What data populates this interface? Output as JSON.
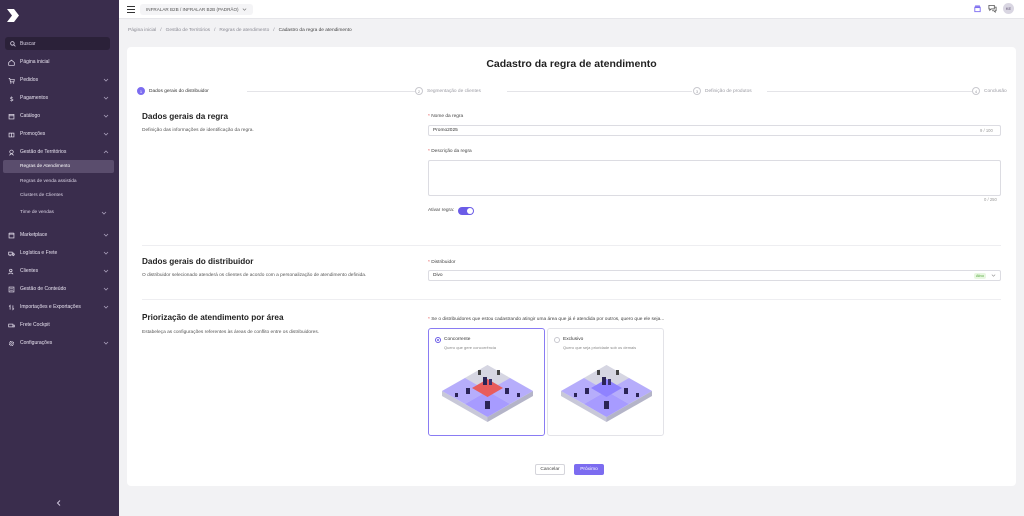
{
  "sidebar": {
    "search_label": "Buscar",
    "items": [
      {
        "label": "Página inicial",
        "icon": "home-icon",
        "chevron": false
      },
      {
        "label": "Pedidos",
        "icon": "cart-icon",
        "chevron": true
      },
      {
        "label": "Pagamentos",
        "icon": "dollar-icon",
        "chevron": true
      },
      {
        "label": "Catálogo",
        "icon": "catalog-icon",
        "chevron": true
      },
      {
        "label": "Promoções",
        "icon": "promo-icon",
        "chevron": true
      },
      {
        "label": "Gestão de Territórios",
        "icon": "territory-icon",
        "chevron": true,
        "expanded": true
      },
      {
        "label": "Marketplace",
        "icon": "marketplace-icon",
        "chevron": true
      },
      {
        "label": "Logística e Frete",
        "icon": "truck-icon",
        "chevron": true
      },
      {
        "label": "Clientes",
        "icon": "users-icon",
        "chevron": true
      },
      {
        "label": "Gestão de Conteúdo",
        "icon": "content-icon",
        "chevron": true
      },
      {
        "label": "Importações e Exportações",
        "icon": "import-export-icon",
        "chevron": true
      },
      {
        "label": "Frete Cockpit",
        "icon": "cockpit-icon",
        "chevron": false
      },
      {
        "label": "Configurações",
        "icon": "gear-icon",
        "chevron": true
      }
    ],
    "sub_items": [
      {
        "label": "Regras de Atendimento",
        "active": true
      },
      {
        "label": "Regras de venda assistida",
        "active": false
      },
      {
        "label": "Clusters de Clientes",
        "active": false
      },
      {
        "label": "Time de vendas",
        "active": false
      }
    ]
  },
  "topbar": {
    "tenant": "INFRALAR B2B / INFRALAR B2B (PADRÃO)",
    "avatar_initials": "KE"
  },
  "breadcrumb": {
    "items": [
      "Página inicial",
      "Gestão de Territórios",
      "Regras de atendimento"
    ],
    "current": "Cadastro da regra de atendimento",
    "separator": "/"
  },
  "page": {
    "title": "Cadastro da regra de atendimento"
  },
  "steps": [
    {
      "num": "1",
      "label": "Dados gerais do distribuidor",
      "active": true
    },
    {
      "num": "2",
      "label": "Segmentação de clientes",
      "active": false
    },
    {
      "num": "3",
      "label": "Definição de produtos",
      "active": false
    },
    {
      "num": "4",
      "label": "Conclusão",
      "active": false
    }
  ],
  "section_rule": {
    "title": "Dados gerais da regra",
    "desc": "Definição das informações de identificação da regra.",
    "name_label": "Nome da regra",
    "name_value": "Promo2025",
    "name_counter": "9 / 100",
    "desc_label": "Descrição da regra",
    "desc_value": "",
    "desc_counter": "0 / 250",
    "active_label": "Ativar regra:",
    "active_on": true
  },
  "section_distributor": {
    "title": "Dados gerais do distribuidor",
    "desc": "O distribuidor selecionado atenderá os clientes de acordo com a personalização de atendimento definida.",
    "field_label": "Distribuidor",
    "value": "Divo",
    "badge": "Ativo"
  },
  "section_priority": {
    "title": "Priorização de atendimento por área",
    "desc": "Estabeleça as configurações referentes às áreas de conflito entre os distribuidores.",
    "question": "Se o distribuidores que estou cadastrando atingir uma área que já é atendida por outros, quero que ele seja...",
    "options": [
      {
        "title": "Concorrente",
        "desc": "Quero que gere concorrência",
        "selected": true
      },
      {
        "title": "Exclusivo",
        "desc": "Quero que seja prioridade sob os demais",
        "selected": false
      }
    ]
  },
  "actions": {
    "cancel": "Cancelar",
    "next": "Próximo"
  },
  "colors": {
    "sidebar_bg": "#3a2d4d",
    "accent": "#7c6cf0",
    "conflict": "#e85c5c",
    "area": "#a79bff"
  }
}
